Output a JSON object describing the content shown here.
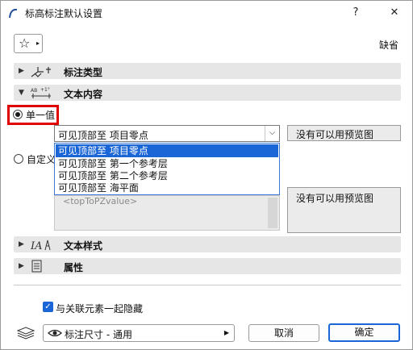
{
  "window": {
    "title": "标高标注默认设置",
    "help_label": "?",
    "close_label": "✕"
  },
  "favorites": {
    "star_glyph": "☆",
    "arrow_glyph": "▸",
    "default_label": "缺省"
  },
  "sections": [
    {
      "label": "标注类型",
      "expanded": false,
      "icon": "dimension-type-icon"
    },
    {
      "label": "文本内容",
      "expanded": true,
      "icon": "text-content-icon"
    },
    {
      "label": "文本样式",
      "expanded": false,
      "icon": "text-style-icon"
    },
    {
      "label": "属性",
      "expanded": false,
      "icon": "properties-icon"
    }
  ],
  "text_content": {
    "single_value_label": "单一值",
    "custom_label": "自定义",
    "selected_value": "可见顶部至 项目零点",
    "options": [
      "可见顶部至 项目零点",
      "可见顶部至 第一个参考层",
      "可见顶部至 第二个参考层",
      "可见顶部至 海平面"
    ],
    "custom_placeholder": "<topToPZvalue>",
    "preview_text_1": "没有可以用预览图",
    "preview_text_2": "没有可以用预览图"
  },
  "footer": {
    "hide_with_element_label": "与关联元素一起隐藏",
    "hide_with_element_checked": true,
    "layer_value": "标注尺寸 - 通用",
    "cancel_label": "取消",
    "ok_label": "确定"
  },
  "colors": {
    "accent": "#1b66d6",
    "highlight_box": "#e00000"
  }
}
